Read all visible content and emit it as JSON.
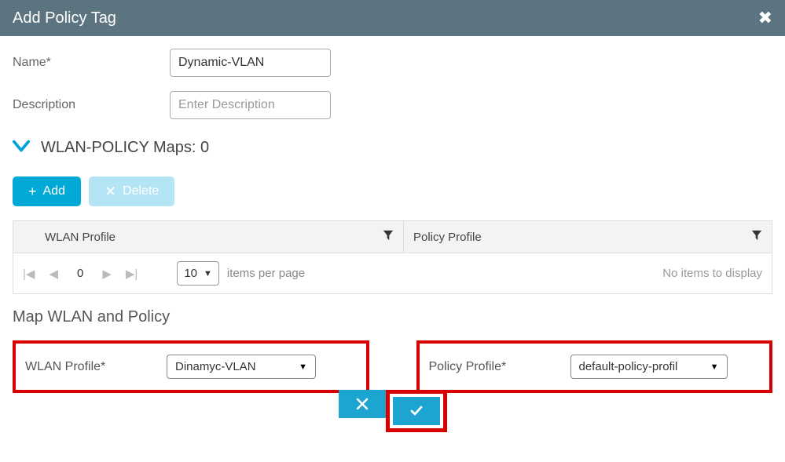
{
  "header": {
    "title": "Add Policy Tag"
  },
  "form": {
    "name_label": "Name*",
    "name_value": "Dynamic-VLAN",
    "description_label": "Description",
    "description_placeholder": "Enter Description"
  },
  "section": {
    "title": "WLAN-POLICY Maps: ",
    "count": "0"
  },
  "buttons": {
    "add": "Add",
    "delete": "Delete"
  },
  "table": {
    "col1": "WLAN Profile",
    "col2": "Policy Profile"
  },
  "pager": {
    "current": "0",
    "page_size": "10",
    "items_per_page": "items per page",
    "no_items": "No items to display"
  },
  "map": {
    "title": "Map WLAN and Policy",
    "wlan_label": "WLAN Profile*",
    "wlan_value": "Dinamyc-VLAN",
    "policy_label": "Policy Profile*",
    "policy_value": "default-policy-profil"
  }
}
